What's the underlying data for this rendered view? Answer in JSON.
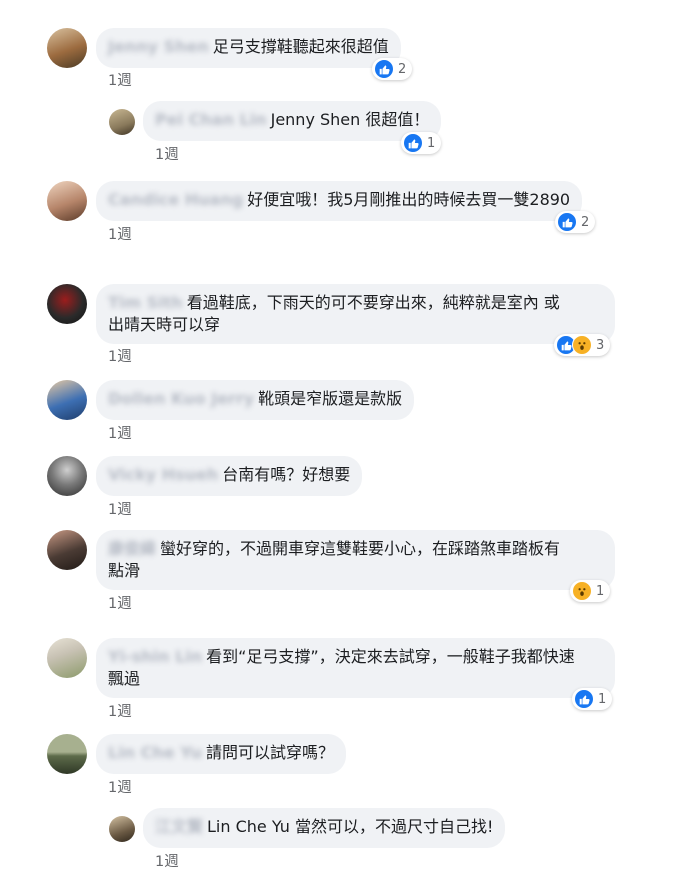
{
  "comments": [
    {
      "author": "Jenny Shen",
      "text": "足弓支撐鞋聽起來很超值",
      "time": "1週",
      "reactions": [
        "like"
      ],
      "count": "2",
      "avatar_colors": [
        "#9c6b3f",
        "#d9c2a0"
      ]
    },
    {
      "author": "Pei Chan Lin",
      "text": "Jenny Shen 很超值！",
      "time": "1週",
      "reactions": [
        "like"
      ],
      "count": "1",
      "avatar_colors": [
        "#8a7a5c",
        "#c9b893"
      ]
    },
    {
      "author": "Candice Huang",
      "text": "好便宜哦！我5月剛推出的時候去買一雙2890",
      "time": "1週",
      "reactions": [
        "like"
      ],
      "count": "2",
      "avatar_colors": [
        "#b6856a",
        "#efd5c0"
      ]
    },
    {
      "author": "Tim Sith",
      "text_line1": "看過鞋底，下雨天的可不要穿出來，純粹就是室內 或",
      "text_line2": "出晴天時可以穿",
      "time": "1週",
      "reactions": [
        "like",
        "wow"
      ],
      "count": "3",
      "avatar_colors": [
        "#2a2a2a",
        "#9c1d1d"
      ]
    },
    {
      "author": "Dollen Kuo Jerry",
      "text": "靴頭是窄版還是款版",
      "time": "1週",
      "avatar_colors": [
        "#3d6fb3",
        "#e6c9a3"
      ]
    },
    {
      "author": "Vicky Hsueh",
      "text": "台南有嗎？好想要",
      "time": "1週",
      "avatar_colors": [
        "#3a3a3a",
        "#cfcfcf"
      ]
    },
    {
      "author": "康俊緯",
      "text_line1": "蠻好穿的，不過開車穿這雙鞋要小心，在踩踏煞車踏板有",
      "text_line2": "點滑",
      "time": "1週",
      "reactions": [
        "wow"
      ],
      "count": "1",
      "avatar_colors": [
        "#4a3b34",
        "#c99a85"
      ]
    },
    {
      "author": "Yi-shin Lin",
      "text_line1": "看到“足弓支撐”，決定來去試穿，一般鞋子我都快速",
      "text_line2": "飄過",
      "time": "1週",
      "reactions": [
        "like"
      ],
      "count": "1",
      "avatar_colors": [
        "#c8c2b4",
        "#8c9a6a"
      ]
    },
    {
      "author": "Lin Che Yu",
      "text": "請問可以試穿嗎？",
      "time": "1週",
      "avatar_colors": [
        "#5d6b4a",
        "#a7b08f"
      ]
    },
    {
      "author": "江文賢",
      "text": "Lin Che Yu 當然可以，不過尺寸自己找!",
      "time": "1週",
      "avatar_colors": [
        "#6b5a44",
        "#d4c2a3"
      ]
    }
  ],
  "icons": {
    "like": "thumbs-up-icon",
    "wow": "wow-face-icon"
  },
  "colors": {
    "like": "#1877f2",
    "wow": "#f7b125",
    "bubble": "#f0f2f5",
    "meta": "#65676b"
  }
}
